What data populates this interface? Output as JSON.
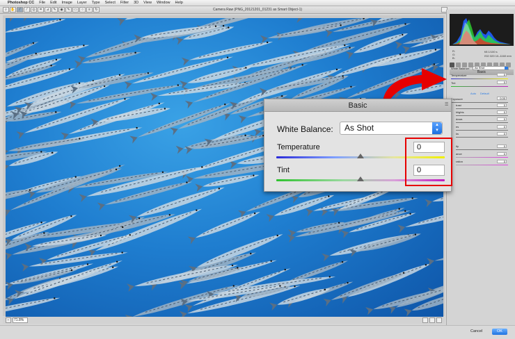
{
  "menubar": {
    "apple": "",
    "items": [
      "Photoshop CC",
      "File",
      "Edit",
      "Image",
      "Layer",
      "Type",
      "Select",
      "Filter",
      "3D",
      "View",
      "Window",
      "Help"
    ]
  },
  "toolbar": {
    "title": "Camera Raw (PNG_20121201_01231 as Smart Object-1)",
    "tools": [
      "zoom-tool",
      "hand-tool",
      "white-balance-tool",
      "color-sampler-tool",
      "targeted-adjustment-tool",
      "crop-tool",
      "straighten-tool",
      "spot-removal-tool",
      "red-eye-tool",
      "adjustment-brush-tool",
      "graduated-filter-tool",
      "radial-filter-tool",
      "preferences-tool",
      "rotate-tool"
    ]
  },
  "status": {
    "zoom": "71.8%"
  },
  "bottom": {
    "cancel": "Cancel",
    "ok": "OK"
  },
  "histogram": {
    "readout_left": [
      "R:",
      "G:",
      "B:"
    ],
    "readout_right_1": "f/8   1/100 s",
    "readout_right_2": "ISO 320   10–1160 mm"
  },
  "small_panel": {
    "title": "Basic",
    "white_balance_label": "White Balance:",
    "white_balance_value": "As Shot",
    "temperature_label": "Temperature",
    "temperature_value": "0",
    "tint_label": "Tint",
    "tint_value": "0",
    "auto": "Auto",
    "default": "Default",
    "exposure_label": "Exposure",
    "exposure_value": "0.00",
    "contrast_label": "trast",
    "contrast_value": "0",
    "highlights_label": "hlights",
    "highlights_value": "0",
    "shadows_label": "dows",
    "shadows_value": "0",
    "whites_label": "es",
    "whites_value": "0",
    "blacks_label": "ks",
    "blacks_value": "0",
    "clarity_label": "ity",
    "clarity_value": "0",
    "vibrance_label": "ance",
    "vibrance_value": "0",
    "saturation_label": "ration",
    "saturation_value": "0"
  },
  "callout": {
    "title": "Basic",
    "white_balance_label": "White Balance:",
    "white_balance_value": "As Shot",
    "temperature_label": "Temperature",
    "temperature_value": "0",
    "tint_label": "Tint",
    "tint_value": "0"
  },
  "colors": {
    "highlight_box": "#e60000",
    "accent_blue": "#2a7be4",
    "water": "#1f7ed0"
  }
}
